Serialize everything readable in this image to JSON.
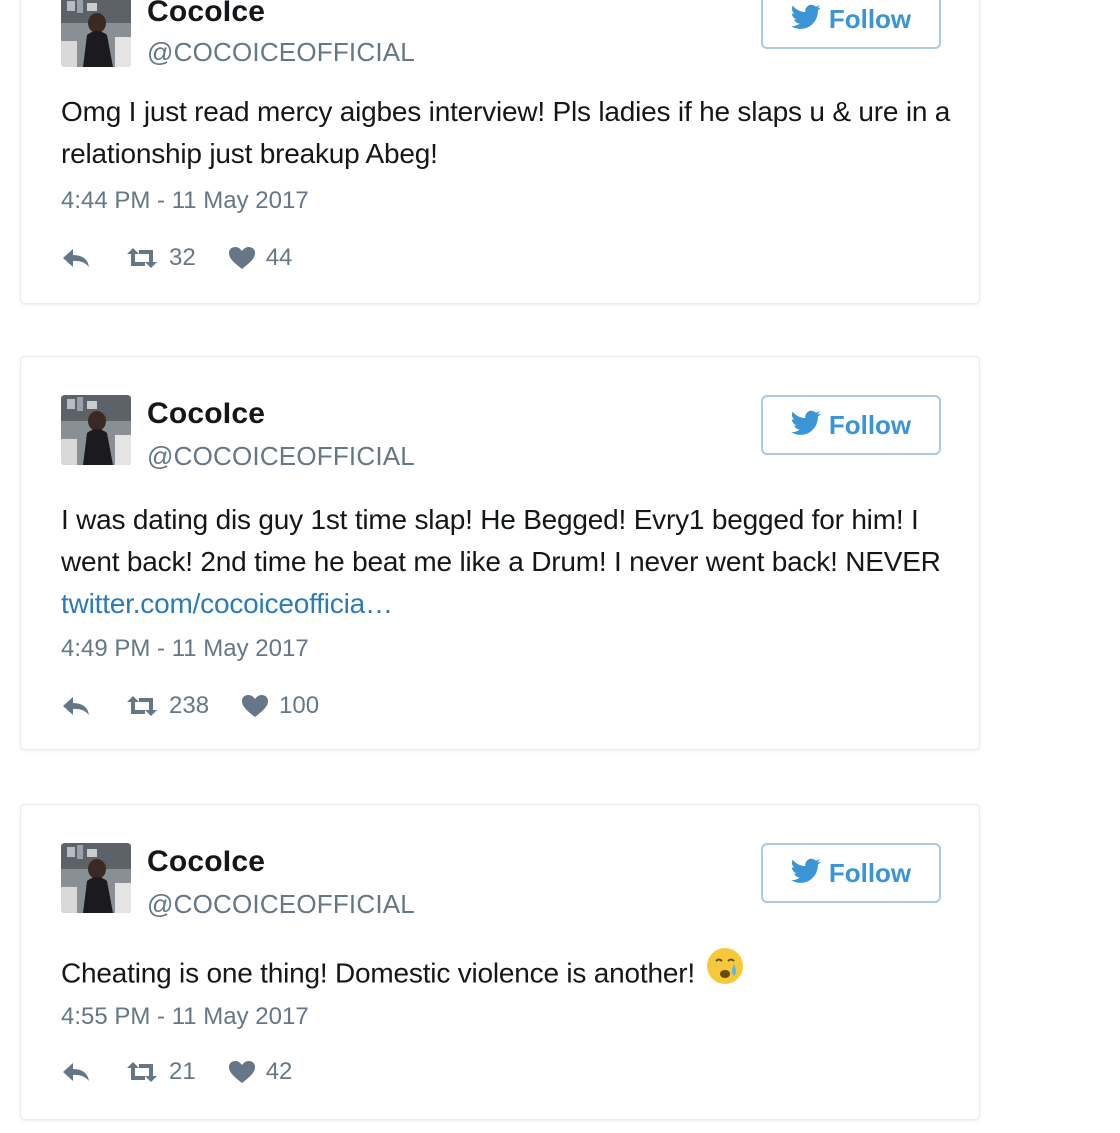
{
  "colors": {
    "text": "#14171a",
    "muted": "#657786",
    "link": "#2b7bb9",
    "follow_blue": "#3a94d6",
    "follow_border": "#a9cbe6",
    "card_border": "#e6ecf0"
  },
  "tweets": [
    {
      "display_name": "CocoIce",
      "handle": "@COCOICEOFFICIAL",
      "follow_label": "Follow",
      "text": "Omg I just read mercy aigbes interview! Pls ladies if he slaps u & ure in a relationship just breakup Abeg!",
      "link": "",
      "emoji": "",
      "timestamp": "4:44 PM - 11 May 2017",
      "retweets": "32",
      "likes": "44"
    },
    {
      "display_name": "CocoIce",
      "handle": "@COCOICEOFFICIAL",
      "follow_label": "Follow",
      "text": "I was dating dis guy 1st time slap! He Begged! Evry1 begged for him! I went back! 2nd time he beat me like a Drum! I never went back! NEVER ",
      "link": "twitter.com/cocoiceofficia…",
      "emoji": "",
      "timestamp": "4:49 PM - 11 May 2017",
      "retweets": "238",
      "likes": "100"
    },
    {
      "display_name": "CocoIce",
      "handle": "@COCOICEOFFICIAL",
      "follow_label": "Follow",
      "text": "Cheating is one thing! Domestic violence is another!",
      "link": "",
      "emoji": "crying-face-emoji",
      "timestamp": "4:55 PM - 11 May 2017",
      "retweets": "21",
      "likes": "42"
    }
  ],
  "icons": {
    "follow": "twitter-bird-icon",
    "reply": "reply-icon",
    "retweet": "retweet-icon",
    "like": "heart-icon"
  }
}
